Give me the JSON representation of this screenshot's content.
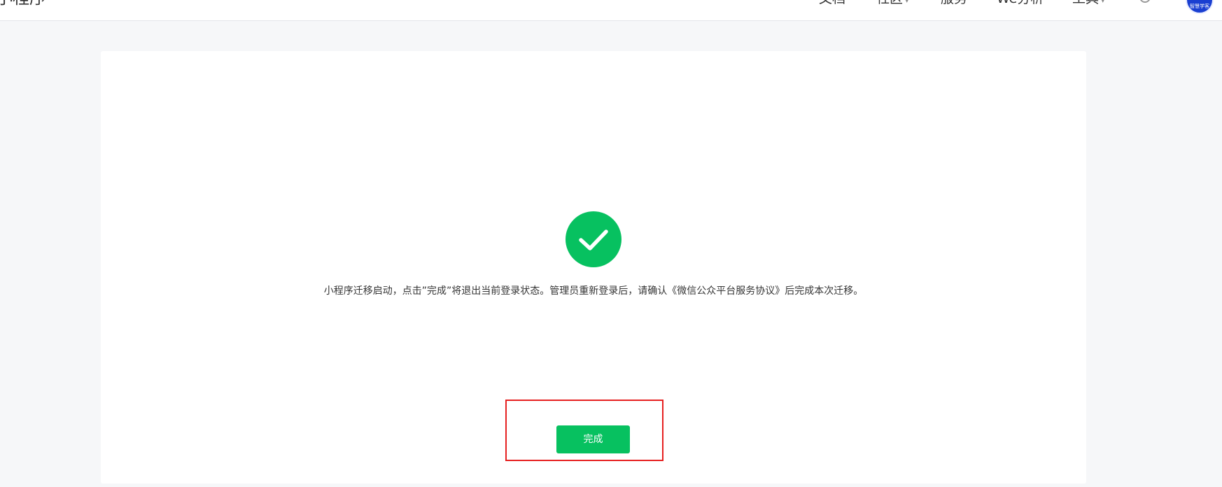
{
  "header": {
    "brand": "小程序",
    "nav": [
      {
        "label": "文档",
        "dropdown": false
      },
      {
        "label": "社区",
        "dropdown": true
      },
      {
        "label": "服务",
        "dropdown": false
      },
      {
        "label": "We分析",
        "dropdown": false
      },
      {
        "label": "工具",
        "dropdown": true
      }
    ],
    "settings_icon": "gear-icon",
    "avatar_text": "智慧学客"
  },
  "result": {
    "status": "success",
    "icon": "check-circle-icon",
    "icon_color": "#07c160",
    "message": "小程序迁移启动，点击”完成”将退出当前登录状态。管理员重新登录后，请确认《微信公众平台服务协议》后完成本次迁移。",
    "done_label": "完成",
    "done_color": "#07c160",
    "highlight_color": "#e62020"
  }
}
